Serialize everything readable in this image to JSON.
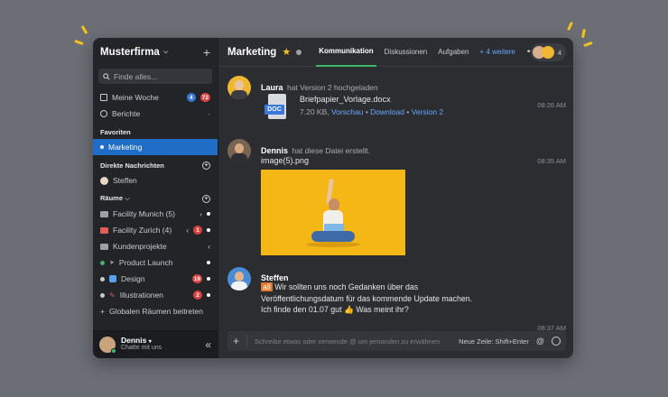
{
  "sidebar": {
    "workspace": "Musterfirma",
    "search_placeholder": "Finde alles...",
    "meine_woche": {
      "label": "Meine Woche",
      "badge1": "4",
      "badge2": "72"
    },
    "berichte": {
      "label": "Berichte",
      "suffix": "-"
    },
    "favoriten_header": "Favoriten",
    "favorit_active": "Marketing",
    "dm_header": "Direkte Nachrichten",
    "dm_user": "Steffen",
    "raeume_header": "Räume",
    "rooms": [
      {
        "label": "Facility Munich (5)"
      },
      {
        "label": "Facility Zurich (4)",
        "badge": "1"
      },
      {
        "label": "Kundenprojekte"
      },
      {
        "label": "Product Launch"
      },
      {
        "label": "Design",
        "badge": "19"
      },
      {
        "label": "Illustrationen",
        "badge": "2"
      }
    ],
    "join_rooms": "Globalen Räumen beitreten",
    "user": {
      "name": "Dennis",
      "status": "Chatte mit uns"
    },
    "colors": {
      "active_bg": "#1f6dc7",
      "badge_red": "#d9423e",
      "badge_blue": "#3b78d8"
    }
  },
  "header": {
    "title": "Marketing",
    "tabs": [
      "Kommunikation",
      "Diskussionen",
      "Aufgaben"
    ],
    "more_tabs": "+ 4 weitere",
    "member_count": "4"
  },
  "messages": {
    "m1": {
      "author": "Laura",
      "action": "hat Version 2 hochgeladen",
      "time": "08:26 AM",
      "file_name": "Briefpapier_Vorlage.docx",
      "file_type": "DOC",
      "file_size": "7.20 KB,",
      "preview": "Vorschau",
      "sep1": "•",
      "download": "Download",
      "sep2": "•",
      "version": "Version 2"
    },
    "m2": {
      "author": "Dennis",
      "action": "hat diese Datei erstellt.",
      "time": "08:35 AM",
      "image_name": "image(5).png"
    },
    "m3": {
      "author": "Steffen",
      "time": "08:37 AM",
      "mention": "all",
      "line1": "Wir sollten uns noch Gedanken über das",
      "line2": "Veröffentlichungsdatum für das kommende Update machen.",
      "line3": "Ich finde den 01.07 gut",
      "line3b": "Was meint ihr?"
    }
  },
  "composer": {
    "placeholder": "Schreibe etwas oder verwende @ um jemanden zu erwähnen",
    "hint": "Neue Zeile: Shift+Enter"
  }
}
